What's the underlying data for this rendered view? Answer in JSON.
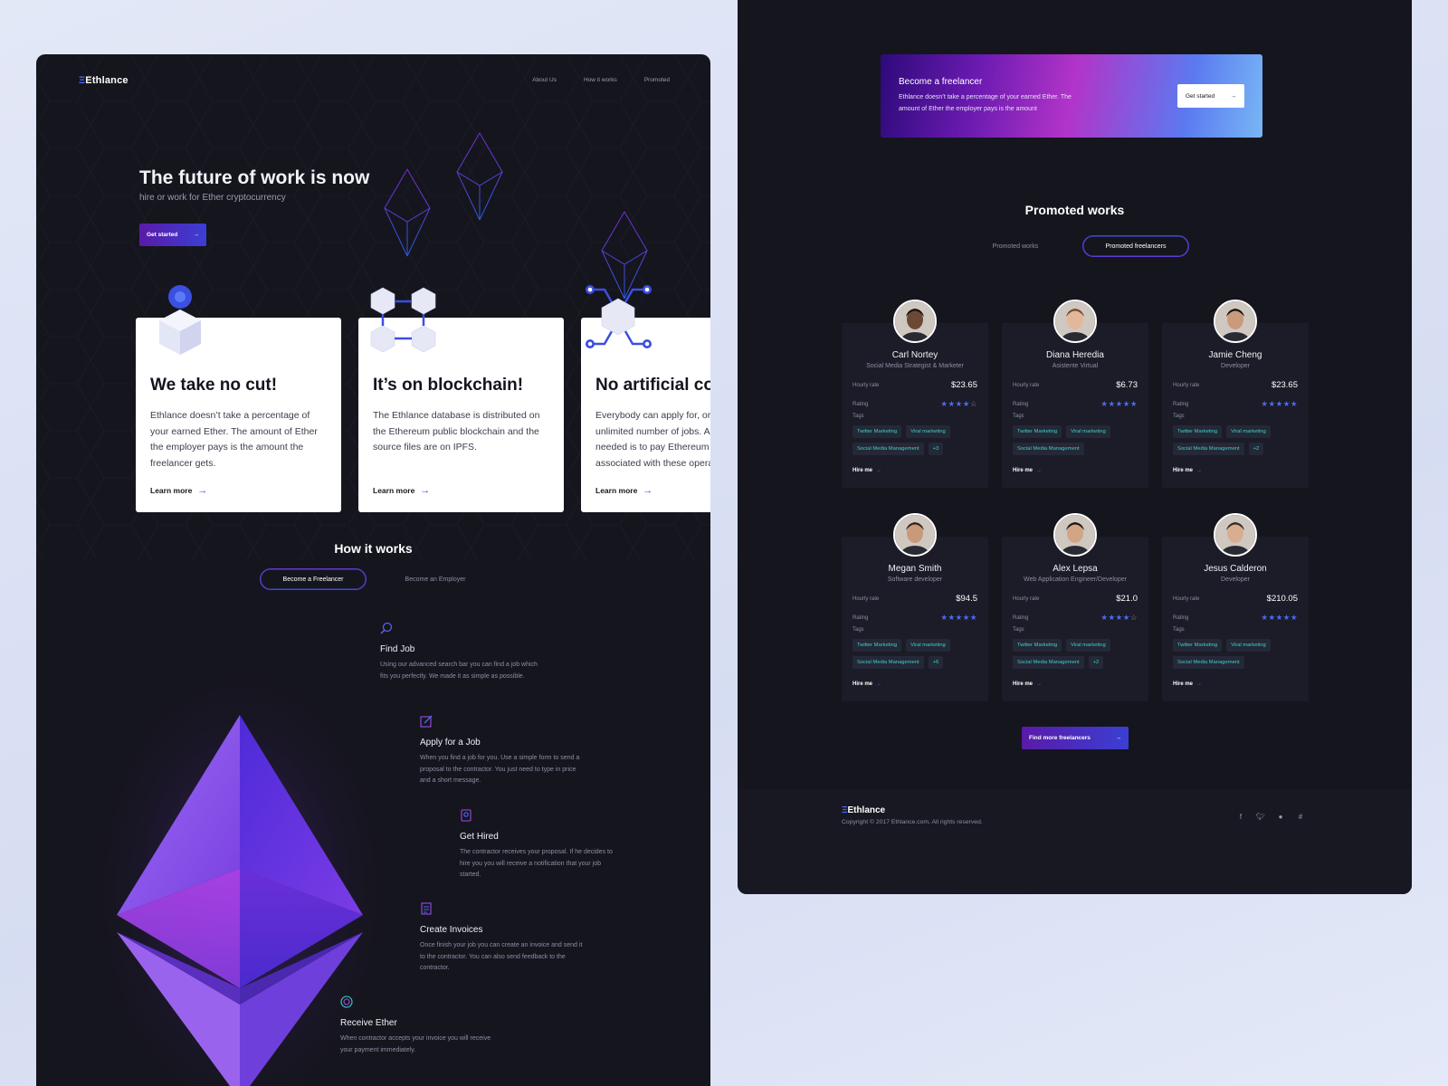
{
  "colors": {
    "accent": "#4a6cf7",
    "panel": "#15151e",
    "tag_text": "#3fd0c4",
    "purple": "#5a1aa8"
  },
  "brand": "Ethlance",
  "nav": [
    "About Us",
    "How it works",
    "Promoted"
  ],
  "hero": {
    "title": "The future of work is now",
    "subtitle": "hire or work for Ether cryptocurrency",
    "cta": "Get started"
  },
  "features": [
    {
      "title": "We take no cut!",
      "text": "Ethlance doesn’t take a percentage of your earned Ether. The amount of Ether the employer pays is the amount the freelancer gets.",
      "link": "Learn more",
      "icon": "cube-user-icon"
    },
    {
      "title": "It’s on blockchain!",
      "text": "The Ethlance database is distributed on the Ethereum public blockchain and the source files are on IPFS.",
      "link": "Learn more",
      "icon": "blockchain-cubes-icon"
    },
    {
      "title": "No artificial costs",
      "text": "Everybody can apply for, or create, an unlimited number of jobs. All that is needed is to pay Ethereum gas fees associated with these operations.",
      "link": "Learn more",
      "icon": "cube-network-icon"
    }
  ],
  "how": {
    "title": "How it works",
    "tabs": [
      "Become a Freelancer",
      "Become an Employer"
    ],
    "steps": [
      {
        "title": "Find Job",
        "text": "Using our advanced search bar you can find a job which fits you perfectly. We made it as simple as possible.",
        "icon": "search-icon"
      },
      {
        "title": "Apply for a Job",
        "text": "When you find a job for you. Use a simple form to send a proposal to the contractor. You just need to type in price and a short message.",
        "icon": "edit-icon"
      },
      {
        "title": "Get Hired",
        "text": "The contractor receives your proposal. If he decides to hire you you will receive a notification that your job started.",
        "icon": "badge-icon"
      },
      {
        "title": "Create Invoices",
        "text": "Once finish your job you can create an invoice and send it to the contractor.  You can also send feedback to the contractor.",
        "icon": "invoice-icon"
      },
      {
        "title": "Receive Ether",
        "text": "When contractor accepts your invoice you will receive your payment immediately.",
        "icon": "coin-icon"
      }
    ]
  },
  "banner": {
    "title": "Become a freelancer",
    "text": "Ethlance doesn’t take a percentage of your earned Ether. The amount of Ether the employer pays is the amount",
    "cta": "Get started"
  },
  "promoted": {
    "title": "Promoted works",
    "tabs": [
      "Promoted works",
      "Promoted freelancers"
    ],
    "labels": {
      "rate": "Hourly rate",
      "rating": "Rating",
      "tags": "Tags",
      "hire": "Hire me"
    },
    "freelancers": [
      {
        "name": "Carl Nortey",
        "role": "Social Media Strategist & Marketer",
        "rate": "$23.65",
        "rating": 4,
        "tags": [
          "Twitter Marketing",
          "Viral marketing",
          "Social Media Management",
          "+3"
        ],
        "skin": "#6b4a35",
        "hair": "#1a1410"
      },
      {
        "name": "Diana Heredia",
        "role": "Asistente Virtual",
        "rate": "$6.73",
        "rating": 5,
        "tags": [
          "Twitter Marketing",
          "Viral marketing",
          "Social Media Management"
        ],
        "skin": "#e3b79a",
        "hair": "#7a4a2a"
      },
      {
        "name": "Jamie Cheng",
        "role": "Developer",
        "rate": "$23.65",
        "rating": 5,
        "tags": [
          "Twitter Marketing",
          "Viral marketing",
          "Social Media Management",
          "+2"
        ],
        "skin": "#c99a7c",
        "hair": "#1a1410"
      },
      {
        "name": "Megan Smith",
        "role": "Software developer",
        "rate": "$94.5",
        "rating": 5,
        "tags": [
          "Twitter Marketing",
          "Viral marketing",
          "Social Media Management",
          "+6"
        ],
        "skin": "#c8997a",
        "hair": "#3a2518"
      },
      {
        "name": "Alex Lepsa",
        "role": "Web Application Engineer/Developer",
        "rate": "$21.0",
        "rating": 4,
        "tags": [
          "Twitter Marketing",
          "Viral marketing",
          "Social Media Management",
          "+2"
        ],
        "skin": "#d2a587",
        "hair": "#1f1712"
      },
      {
        "name": "Jesus Calderon",
        "role": "Developer",
        "rate": "$210.05",
        "rating": 5,
        "tags": [
          "Twitter Marketing",
          "Viral marketing",
          "Social Media Management"
        ],
        "skin": "#d9ae90",
        "hair": "#3a2a1e"
      }
    ],
    "cta": "Find more freelancers"
  },
  "footer": {
    "brand": "Ethlance",
    "copyright": "Copyright © 2017 Ethlance.com. All rights reserved.",
    "social": [
      "facebook-icon",
      "twitter-icon",
      "github-icon",
      "slack-icon"
    ]
  }
}
